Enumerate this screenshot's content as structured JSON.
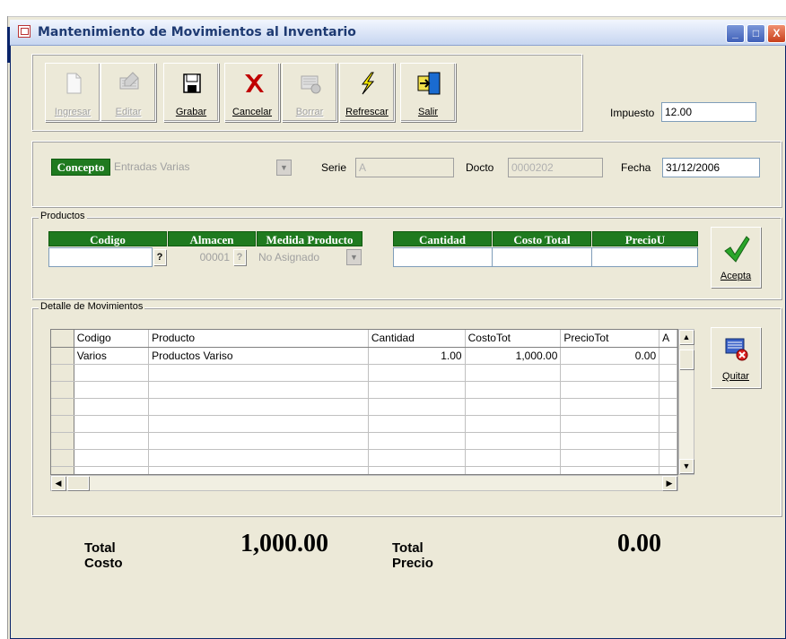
{
  "window": {
    "title": "Mantenimiento de Movimientos al Inventario",
    "minimize": "_",
    "maximize": "□",
    "close": "X"
  },
  "toolbar": {
    "buttons": [
      {
        "label": "Ingresar",
        "icon": "document-icon",
        "enabled": false
      },
      {
        "label": "Editar",
        "icon": "edit-keyboard-icon",
        "enabled": false
      },
      {
        "label": "Grabar",
        "icon": "floppy-save-icon",
        "enabled": true
      },
      {
        "label": "Cancelar",
        "icon": "red-x-cancel-icon",
        "enabled": true
      },
      {
        "label": "Borrar",
        "icon": "delete-keyboard-icon",
        "enabled": false
      },
      {
        "label": "Refrescar",
        "icon": "lightning-refresh-icon",
        "enabled": true
      },
      {
        "label": "Salir",
        "icon": "exit-door-icon",
        "enabled": true
      }
    ],
    "impuesto_label": "Impuesto",
    "impuesto_value": "12.00"
  },
  "header_form": {
    "concepto_label": "Concepto",
    "concepto_value": "Entradas Varias",
    "serie_label": "Serie",
    "serie_value": "A",
    "docto_label": "Docto",
    "docto_value": "0000202",
    "fecha_label": "Fecha",
    "fecha_value": "31/12/2006"
  },
  "productos": {
    "group_label": "Productos",
    "headers": {
      "codigo": "Codigo",
      "almacen": "Almacen",
      "medida": "Medida Producto",
      "cantidad": "Cantidad",
      "costo_total": "Costo Total",
      "precio_u": "PrecioU"
    },
    "almacen_value": "00001",
    "medida_value": "No Asignado",
    "lookup_glyph": "?",
    "acepta_label": "Acepta"
  },
  "detalle": {
    "group_label": "Detalle de Movimientos",
    "columns": [
      "Codigo",
      "Producto",
      "Cantidad",
      "CostoTot",
      "PrecioTot",
      "A"
    ],
    "rows": [
      [
        "Varios",
        "Productos Variso",
        "1.00",
        "1,000.00",
        "0.00",
        ""
      ]
    ],
    "quitar_label": "Quitar"
  },
  "totals": {
    "costo_label_1": "Total",
    "costo_label_2": "Costo",
    "costo_value": "1,000.00",
    "precio_label_1": "Total",
    "precio_label_2": "Precio",
    "precio_value": "0.00"
  },
  "colors": {
    "header_green": "#1f7a1f",
    "title_blue": "#1e3a72",
    "window_bg": "#ece9d8"
  }
}
